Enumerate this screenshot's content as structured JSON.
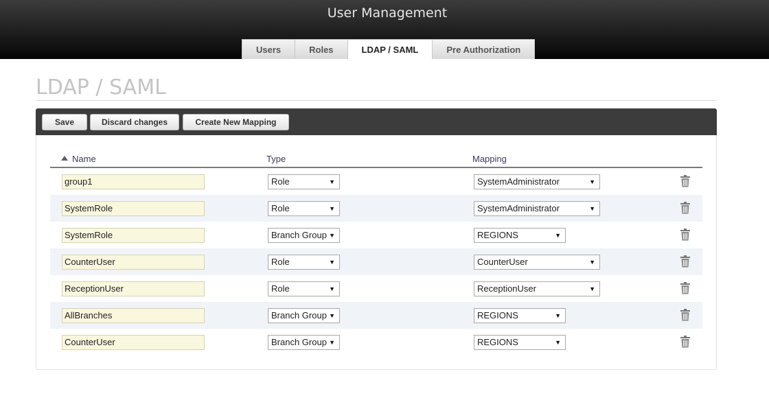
{
  "header": {
    "title": "User Management"
  },
  "tabs": [
    {
      "label": "Users"
    },
    {
      "label": "Roles"
    },
    {
      "label": "LDAP / SAML",
      "active": true
    },
    {
      "label": "Pre Authorization"
    }
  ],
  "page": {
    "title": "LDAP / SAML"
  },
  "toolbar": {
    "save": "Save",
    "discard": "Discard changes",
    "create": "Create New Mapping"
  },
  "table": {
    "columns": {
      "name": "Name",
      "type": "Type",
      "mapping": "Mapping"
    },
    "sort": {
      "column": "Name",
      "direction": "ascending"
    },
    "rows": [
      {
        "name": "group1",
        "type": "Role",
        "mapping": "SystemAdministrator"
      },
      {
        "name": "SystemRole",
        "type": "Role",
        "mapping": "SystemAdministrator"
      },
      {
        "name": "SystemRole",
        "type": "Branch Group",
        "mapping": "REGIONS"
      },
      {
        "name": "CounterUser",
        "type": "Role",
        "mapping": "CounterUser"
      },
      {
        "name": "ReceptionUser",
        "type": "Role",
        "mapping": "ReceptionUser"
      },
      {
        "name": "AllBranches",
        "type": "Branch Group",
        "mapping": "REGIONS"
      },
      {
        "name": "CounterUser",
        "type": "Branch Group",
        "mapping": "REGIONS"
      }
    ]
  },
  "icons": {
    "delete": "trash-icon",
    "sort": "sort-ascending-icon",
    "dropdown": "dropdown-arrow-icon"
  },
  "colors": {
    "header_bg": "#1e1e1e",
    "name_input_bg": "#faf7df",
    "alt_row_bg": "#f0f4f8",
    "toolbar_bg": "#3c3c3c"
  }
}
